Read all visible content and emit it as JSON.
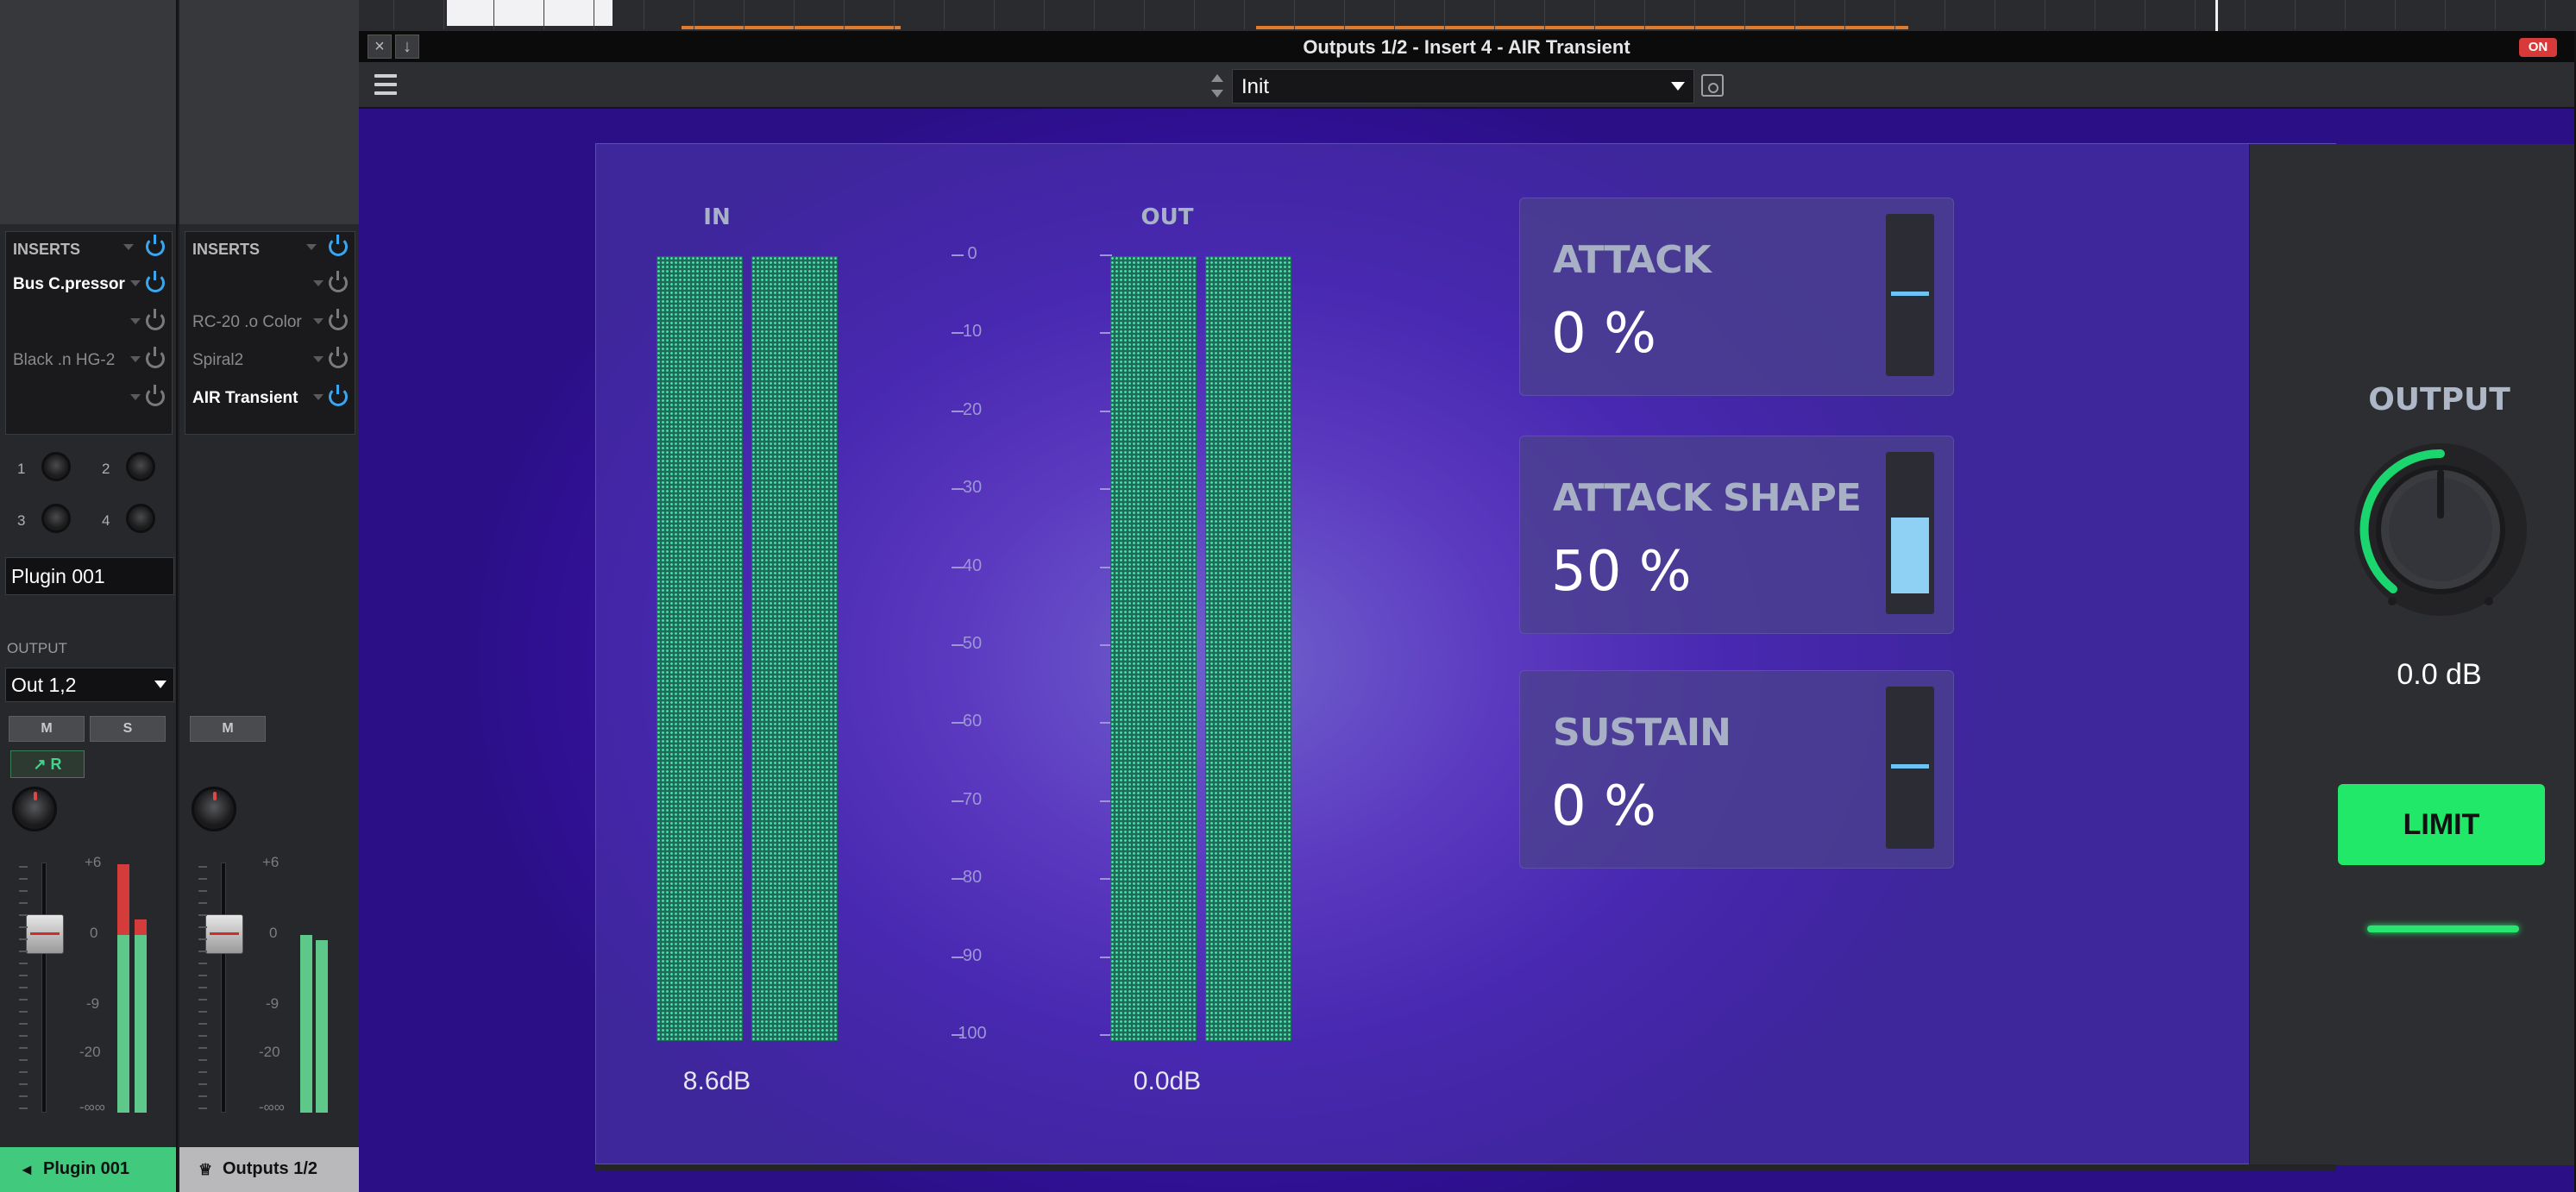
{
  "colors": {
    "accent_green": "#22e86a",
    "meter_green": "#49e4aa",
    "param_blue": "#8ed1f5",
    "on_red": "#d83a3a",
    "power_blue": "#3aa6f0"
  },
  "mixer": {
    "strip1": {
      "inserts_label": "INSERTS",
      "inserts": [
        "Bus C.pressor",
        "",
        "Black .n HG-2",
        ""
      ],
      "sends": [
        "1",
        "2",
        "3",
        "4"
      ],
      "name": "Plugin 001",
      "output_label": "OUTPUT",
      "output": "Out 1,2",
      "mute": "M",
      "solo": "S",
      "read": "R",
      "scale": [
        "+6",
        "0",
        "-9",
        "-20",
        "-∞∞"
      ],
      "channel_name": "Plugin 001"
    },
    "strip2": {
      "inserts_label": "INSERTS",
      "inserts": [
        "",
        "RC-20 .o Color",
        "Spiral2",
        "AIR Transient"
      ],
      "mute": "M",
      "scale": [
        "+6",
        "0",
        "-9",
        "-20",
        "-∞∞"
      ],
      "channel_name": "Outputs 1/2"
    }
  },
  "window": {
    "title": "Outputs 1/2 - Insert 4 - AIR Transient",
    "on_badge": "ON",
    "preset": "Init"
  },
  "plugin": {
    "in_label": "IN",
    "out_label": "OUT",
    "in_value": "8.6dB",
    "out_value": "0.0dB",
    "db_scale": [
      "0",
      "10",
      "20",
      "30",
      "40",
      "50",
      "60",
      "70",
      "80",
      "90",
      "100"
    ],
    "params": [
      {
        "name": "ATTACK",
        "value": "0 %",
        "level": 0.0
      },
      {
        "name": "ATTACK SHAPE",
        "value": "50 %",
        "level": 0.5
      },
      {
        "name": "SUSTAIN",
        "value": "0 %",
        "level": 0.0
      }
    ],
    "output_title": "OUTPUT",
    "output_value": "0.0 dB",
    "limit_label": "LIMIT"
  }
}
